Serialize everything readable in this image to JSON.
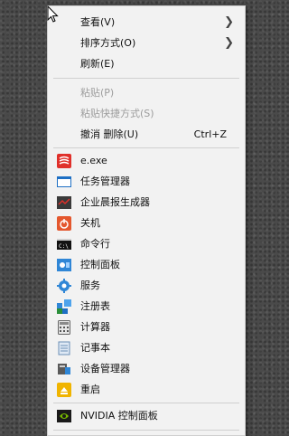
{
  "menu": {
    "view": "查看(V)",
    "sort": "排序方式(O)",
    "refresh": "刷新(E)",
    "paste": "粘贴(P)",
    "paste_shortcut": "粘贴快捷方式(S)",
    "undo_delete": "撤消 删除(U)",
    "undo_shortcut": "Ctrl+Z",
    "eexe": "e.exe",
    "task_manager": "任务管理器",
    "report_gen": "企业晨报生成器",
    "shutdown": "关机",
    "cmd": "命令行",
    "control_panel": "控制面板",
    "services": "服务",
    "regedit": "注册表",
    "calculator": "计算器",
    "notepad": "记事本",
    "device_manager": "设备管理器",
    "restart": "重启",
    "nvidia": "NVIDIA 控制面板"
  },
  "colors": {
    "menu_bg": "#f2f2f2",
    "disabled_text": "#9c9c9c",
    "accent_red": "#e0302a",
    "accent_blue": "#1e6fc4",
    "nvidia_green": "#76b900"
  }
}
